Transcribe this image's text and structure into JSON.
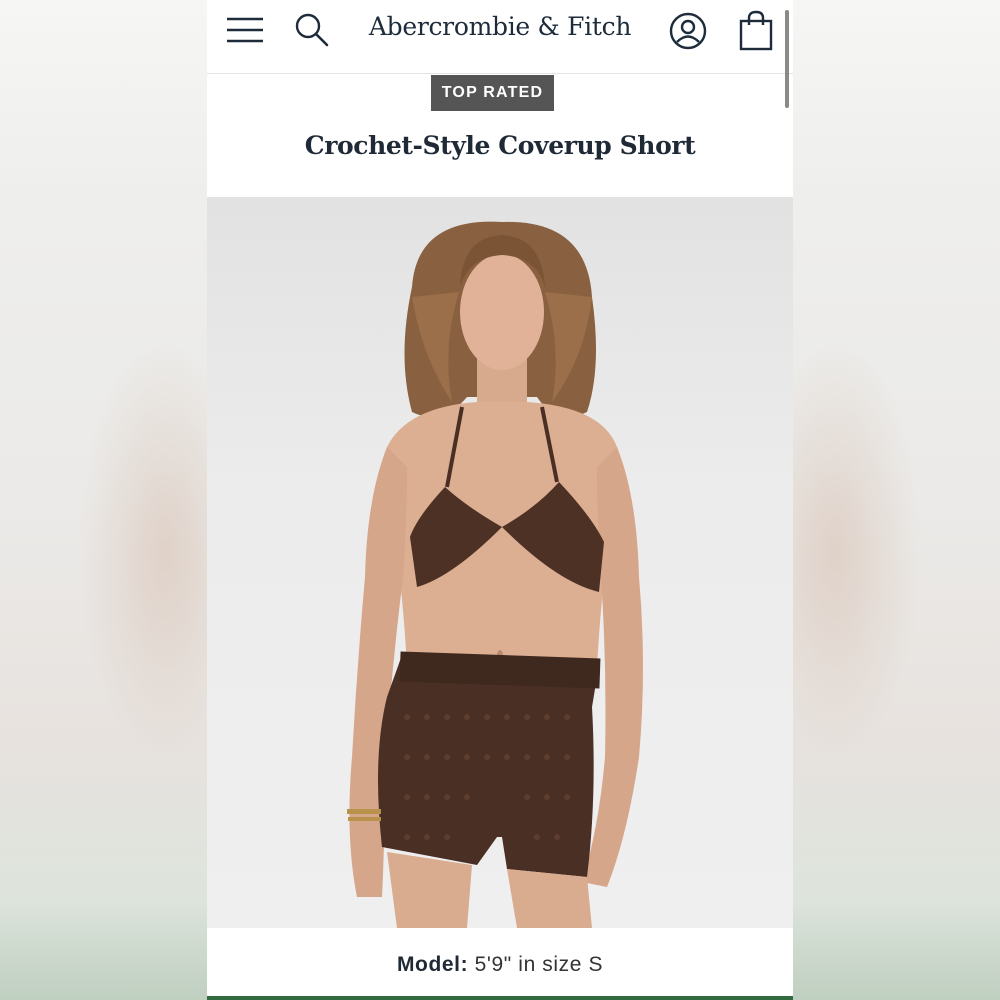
{
  "header": {
    "brand": "Abercrombie & Fitch",
    "icons": [
      "menu-icon",
      "search-icon",
      "account-icon",
      "shopping-bag-icon"
    ]
  },
  "product": {
    "badge": "TOP RATED",
    "title": "Crochet-Style Coverup Short",
    "model_label": "Model:",
    "model_value": "5'9\" in size S"
  },
  "colors": {
    "brand_text": "#1d2b3a",
    "badge_bg": "#555555",
    "product_brown": "#4a2f24"
  }
}
